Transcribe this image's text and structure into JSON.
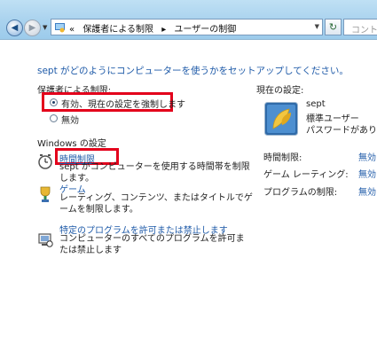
{
  "address": {
    "back_glyph": "◀",
    "fwd_glyph": "▶",
    "dropdown_glyph": "▼",
    "overflow_glyph": "«",
    "crumbs": [
      "保護者による制限",
      "ユーザーの制御"
    ],
    "separator": "▸",
    "refresh_glyph": "↻",
    "search_placeholder": "コントロ"
  },
  "main": {
    "heading": "sept がどのようにコンピューターを使うかをセットアップしてください。",
    "parental_label": "保護者による制限:",
    "options": [
      {
        "label": "有効、現在の設定を強制します",
        "selected": true
      },
      {
        "label": "無効",
        "selected": false
      }
    ],
    "windows_settings_label": "Windows の設定",
    "settings": [
      {
        "title": "時間制限",
        "desc": "sept がコンピューターを使用する時間帯を制限します。",
        "icon": "clock-icon"
      },
      {
        "title": "ゲーム",
        "desc": "レーティング、コンテンツ、またはタイトルでゲームを制限します。",
        "icon": "trophy-icon"
      },
      {
        "title": "特定のプログラムを許可または禁止します",
        "desc": "コンピューターのすべてのプログラムを許可または禁止します",
        "icon": "program-icon"
      }
    ]
  },
  "side": {
    "current_settings_label": "現在の設定:",
    "user_name": "sept",
    "user_type": "標準ユーザー",
    "password_text": "パスワードがありま",
    "rows": [
      {
        "label": "時間制限:",
        "value": "無効"
      },
      {
        "label": "ゲーム レーティング:",
        "value": "無効"
      },
      {
        "label": "プログラムの制限:",
        "value": "無効"
      }
    ]
  },
  "colors": {
    "link": "#1e5aa8",
    "highlight_box": "#e3001b",
    "titlebar": "#a9d2ee"
  }
}
